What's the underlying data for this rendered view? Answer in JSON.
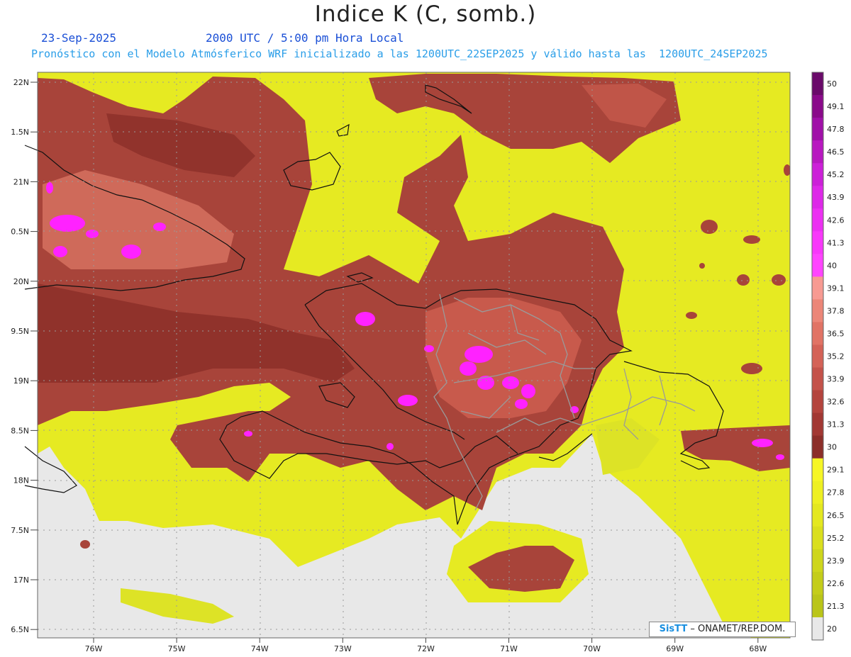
{
  "title": "Indice K (C, somb.)",
  "date": "23-Sep-2025",
  "time": "2000 UTC / 5:00 pm Hora Local",
  "subtitle": "Pronóstico con el Modelo Atmósferico WRF inicializado a las 1200UTC_22SEP2025 y válido hasta las  1200UTC_24SEP2025",
  "credit": {
    "brand": "SisTT",
    "org": "– ONAMET/REP.DOM."
  },
  "map": {
    "lat_labels": [
      "22N",
      "1.5N",
      "21N",
      "0.5N",
      "20N",
      "9.5N",
      "19N",
      "8.5N",
      "18N",
      "7.5N",
      "17N",
      "6.5N"
    ],
    "lon_labels": [
      "76W",
      "75W",
      "74W",
      "73W",
      "72W",
      "71W",
      "70W",
      "69W",
      "68W"
    ]
  },
  "colorbar": {
    "labels": [
      "50",
      "49.1",
      "47.8",
      "46.5",
      "45.2",
      "43.9",
      "42.6",
      "41.3",
      "40",
      "39.1",
      "37.8",
      "36.5",
      "35.2",
      "33.9",
      "32.6",
      "31.3",
      "30",
      "29.1",
      "27.8",
      "26.5",
      "25.2",
      "23.9",
      "22.6",
      "21.3",
      "20"
    ],
    "colors": [
      "#6a0a6a",
      "#8a0a8a",
      "#a010a8",
      "#b818c0",
      "#cc20d8",
      "#dd28e8",
      "#ec30f2",
      "#f838fa",
      "#ff44ff",
      "#f79a92",
      "#ec8678",
      "#e17365",
      "#d46257",
      "#c4524a",
      "#b4443d",
      "#a23833",
      "#8c2e29",
      "#f6f626",
      "#eef022",
      "#e4e820",
      "#dadf1e",
      "#ced61c",
      "#c4cd1a",
      "#bac519",
      "#e8e8e8"
    ]
  }
}
